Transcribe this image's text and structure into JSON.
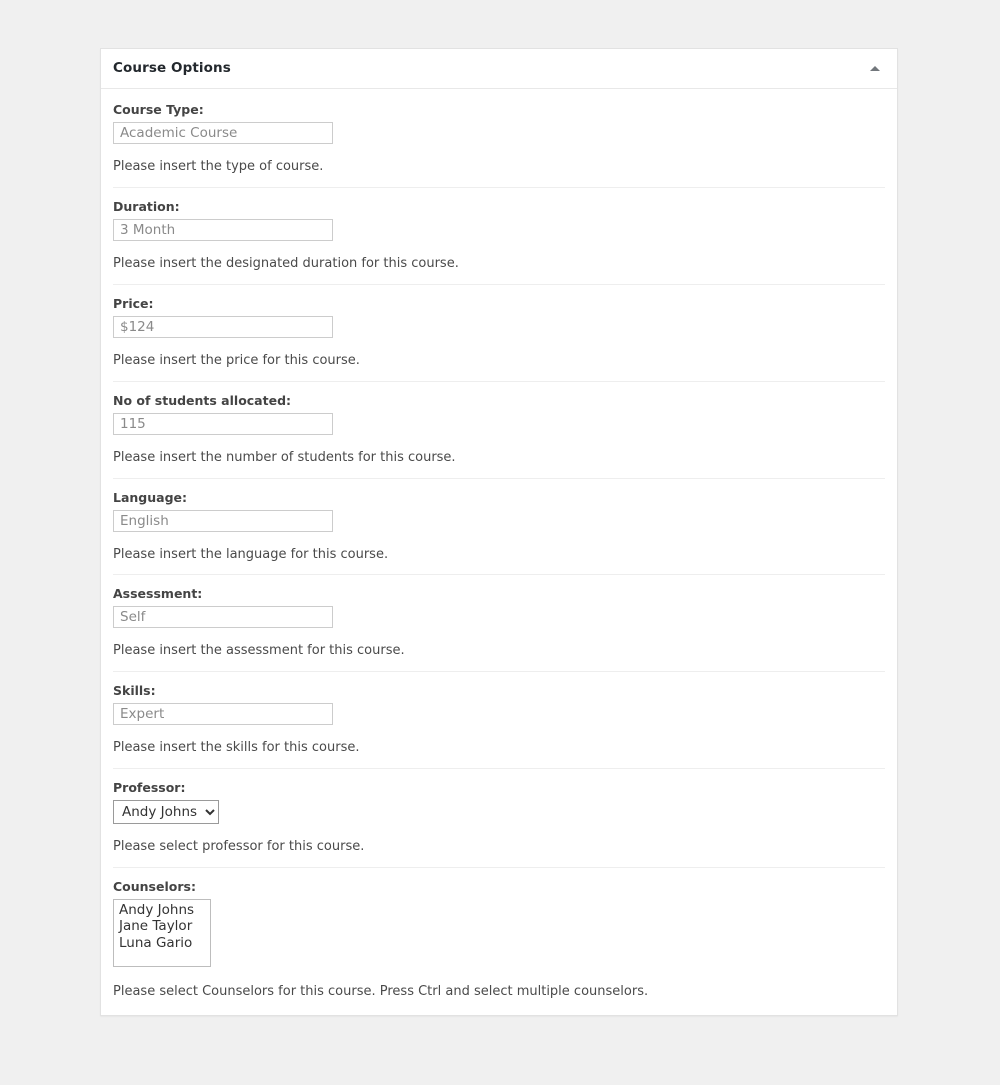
{
  "panel": {
    "title": "Course Options",
    "toggle_icon": "caret-up-icon"
  },
  "fields": [
    {
      "label": "Course Type:",
      "type": "text",
      "value": "Academic Course",
      "help": "Please insert the type of course."
    },
    {
      "label": "Duration:",
      "type": "text",
      "value": "3 Month",
      "help": "Please insert the designated duration for this course."
    },
    {
      "label": "Price:",
      "type": "text",
      "value": "$124",
      "help": "Please insert the price for this course."
    },
    {
      "label": "No of students allocated:",
      "type": "text",
      "value": "115",
      "help": "Please insert the number of students for this course."
    },
    {
      "label": "Language:",
      "type": "text",
      "value": "English",
      "help": "Please insert the language for this course."
    },
    {
      "label": "Assessment:",
      "type": "text",
      "value": "Self",
      "help": "Please insert the assessment for this course."
    },
    {
      "label": "Skills:",
      "type": "text",
      "value": "Expert",
      "help": "Please insert the skills for this course."
    },
    {
      "label": "Professor:",
      "type": "select",
      "selected": "Andy Johns",
      "options": [
        "Andy Johns",
        "Jane Taylor",
        "Luna Gario"
      ],
      "help": "Please select professor for this course."
    },
    {
      "label": "Counselors:",
      "type": "multiselect",
      "options": [
        "Andy Johns",
        "Jane Taylor",
        "Luna Gario"
      ],
      "help": "Please select Counselors for this course. Press Ctrl and select multiple counselors."
    }
  ],
  "colors": {
    "page_background": "#f0f0f0",
    "panel_background": "#ffffff",
    "panel_border": "#e2e2e2",
    "title_text": "#23282d",
    "label_text": "#444444",
    "help_text": "#4a4a4a",
    "input_border": "#cccccc",
    "input_text": "#8a8a8a",
    "divider": "#eeeeee",
    "caret": "#72777c"
  }
}
